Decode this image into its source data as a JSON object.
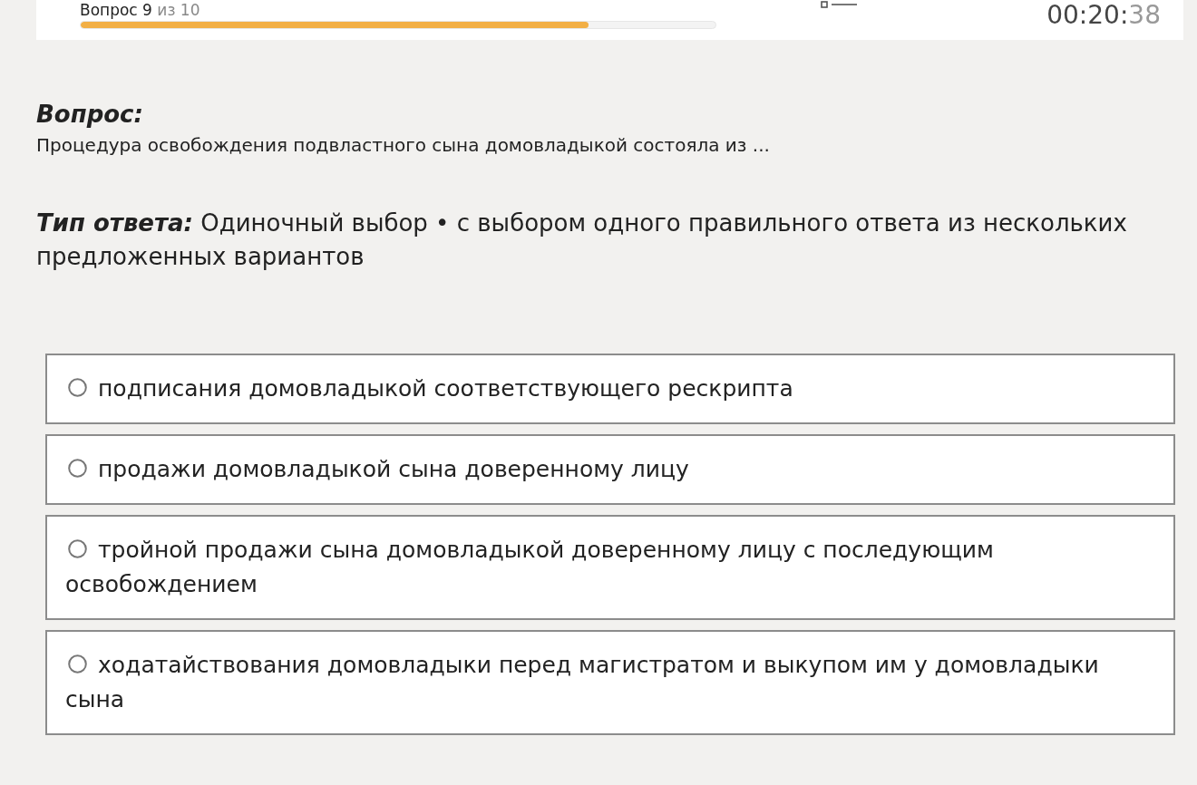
{
  "header": {
    "progress": {
      "label": "Вопрос 9",
      "suffix": "из 10",
      "level": 0.8
    },
    "timer": {
      "main": "00:20:",
      "seconds": "38"
    }
  },
  "question": {
    "heading": "Вопрос:",
    "text": "Процедура освобождения подвластного сына домовладыкой состояла из ..."
  },
  "answer_type": {
    "label": "Тип ответа:",
    "text": "Одиночный выбор • с выбором одного правильного ответа из нескольких предложенных вариантов"
  },
  "options": [
    {
      "text": "подписания домовладыкой соответствующего рескрипта",
      "selected": false
    },
    {
      "text": "продажи домовладыкой сына доверенному лицу",
      "selected": false
    },
    {
      "text": "тройной продажи сына домовладыкой доверенному лицу с последующим освобождением",
      "selected": false
    },
    {
      "text": "ходатайствования домовладыки перед магистратом и выкупом им у домовладыки сына",
      "selected": false
    }
  ]
}
